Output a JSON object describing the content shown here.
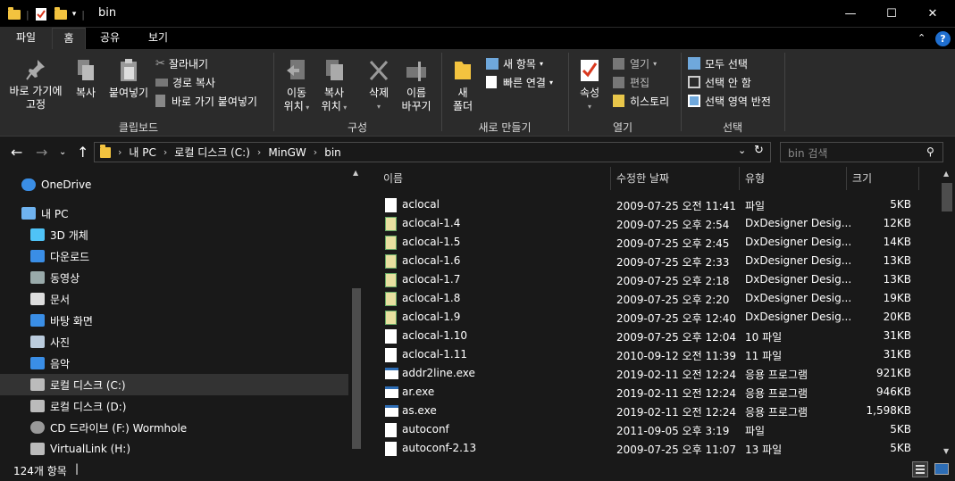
{
  "window": {
    "title": "bin",
    "qa_separator": "|",
    "buttons": {
      "minimize": "—",
      "maximize": "☐",
      "close": "✕"
    }
  },
  "ribbon_tabs": {
    "file": "파일",
    "home": "홈",
    "share": "공유",
    "view": "보기"
  },
  "ribbon": {
    "clipboard": {
      "pin": [
        "바로 가기에",
        "고정"
      ],
      "copy": "복사",
      "paste": "붙여넣기",
      "cut": "잘라내기",
      "copy_path": "경로 복사",
      "paste_shortcut": "바로 가기 붙여넣기",
      "label": "클립보드"
    },
    "organize": {
      "move_to": [
        "이동",
        "위치"
      ],
      "copy_to": [
        "복사",
        "위치"
      ],
      "delete": "삭제",
      "rename": [
        "이름",
        "바꾸기"
      ],
      "label": "구성"
    },
    "new": {
      "new_folder": [
        "새",
        "폴더"
      ],
      "new_item": "새 항목",
      "easy_access": "빠른 연결",
      "label": "새로 만들기"
    },
    "open": {
      "properties": "속성",
      "open": "열기",
      "edit": "편집",
      "history": "히스토리",
      "label": "열기"
    },
    "select": {
      "select_all": "모두 선택",
      "select_none": "선택 안 함",
      "invert": "선택 영역 반전",
      "label": "선택"
    }
  },
  "address": {
    "crumbs": [
      "내 PC",
      "로컬 디스크 (C:)",
      "MinGW",
      "bin"
    ],
    "search_placeholder": "bin 검색"
  },
  "nav_pane": [
    {
      "label": "OneDrive",
      "icon": "cloud-icon"
    },
    {
      "label": "내 PC",
      "icon": "pc-icon"
    },
    {
      "label": "3D 개체",
      "icon": "cube-icon"
    },
    {
      "label": "다운로드",
      "icon": "download-icon"
    },
    {
      "label": "동영상",
      "icon": "video-icon"
    },
    {
      "label": "문서",
      "icon": "document-icon"
    },
    {
      "label": "바탕 화면",
      "icon": "desktop-icon"
    },
    {
      "label": "사진",
      "icon": "picture-icon"
    },
    {
      "label": "음악",
      "icon": "music-icon"
    },
    {
      "label": "로컬 디스크 (C:)",
      "icon": "drive-icon"
    },
    {
      "label": "로컬 디스크 (D:)",
      "icon": "drive-icon"
    },
    {
      "label": "CD 드라이브 (F:) Wormhole",
      "icon": "cd-icon"
    },
    {
      "label": "VirtualLink (H:)",
      "icon": "drive-icon"
    }
  ],
  "columns": {
    "name": "이름",
    "date": "수정한 날짜",
    "type": "유형",
    "size": "크기"
  },
  "files": [
    {
      "name": "aclocal",
      "date": "2009-07-25 오전 11:41",
      "type": "파일",
      "size": "5KB",
      "icon": "file-icon"
    },
    {
      "name": "aclocal-1.4",
      "date": "2009-07-25 오후 2:54",
      "type": "DxDesigner Desig...",
      "size": "12KB",
      "icon": "dxdesigner-file-icon"
    },
    {
      "name": "aclocal-1.5",
      "date": "2009-07-25 오후 2:45",
      "type": "DxDesigner Desig...",
      "size": "14KB",
      "icon": "dxdesigner-file-icon"
    },
    {
      "name": "aclocal-1.6",
      "date": "2009-07-25 오후 2:33",
      "type": "DxDesigner Desig...",
      "size": "13KB",
      "icon": "dxdesigner-file-icon"
    },
    {
      "name": "aclocal-1.7",
      "date": "2009-07-25 오후 2:18",
      "type": "DxDesigner Desig...",
      "size": "13KB",
      "icon": "dxdesigner-file-icon"
    },
    {
      "name": "aclocal-1.8",
      "date": "2009-07-25 오후 2:20",
      "type": "DxDesigner Desig...",
      "size": "19KB",
      "icon": "dxdesigner-file-icon"
    },
    {
      "name": "aclocal-1.9",
      "date": "2009-07-25 오후 12:40",
      "type": "DxDesigner Desig...",
      "size": "20KB",
      "icon": "dxdesigner-file-icon"
    },
    {
      "name": "aclocal-1.10",
      "date": "2009-07-25 오후 12:04",
      "type": "10 파일",
      "size": "31KB",
      "icon": "file-icon"
    },
    {
      "name": "aclocal-1.11",
      "date": "2010-09-12 오전 11:39",
      "type": "11 파일",
      "size": "31KB",
      "icon": "file-icon"
    },
    {
      "name": "addr2line.exe",
      "date": "2019-02-11 오전 12:24",
      "type": "응용 프로그램",
      "size": "921KB",
      "icon": "exe-icon"
    },
    {
      "name": "ar.exe",
      "date": "2019-02-11 오전 12:24",
      "type": "응용 프로그램",
      "size": "946KB",
      "icon": "exe-icon"
    },
    {
      "name": "as.exe",
      "date": "2019-02-11 오전 12:24",
      "type": "응용 프로그램",
      "size": "1,598KB",
      "icon": "exe-icon"
    },
    {
      "name": "autoconf",
      "date": "2011-09-05 오후 3:19",
      "type": "파일",
      "size": "5KB",
      "icon": "file-icon"
    },
    {
      "name": "autoconf-2.13",
      "date": "2009-07-25 오후 11:07",
      "type": "13 파일",
      "size": "5KB",
      "icon": "file-icon"
    }
  ],
  "status": {
    "count": "124개 항목"
  }
}
